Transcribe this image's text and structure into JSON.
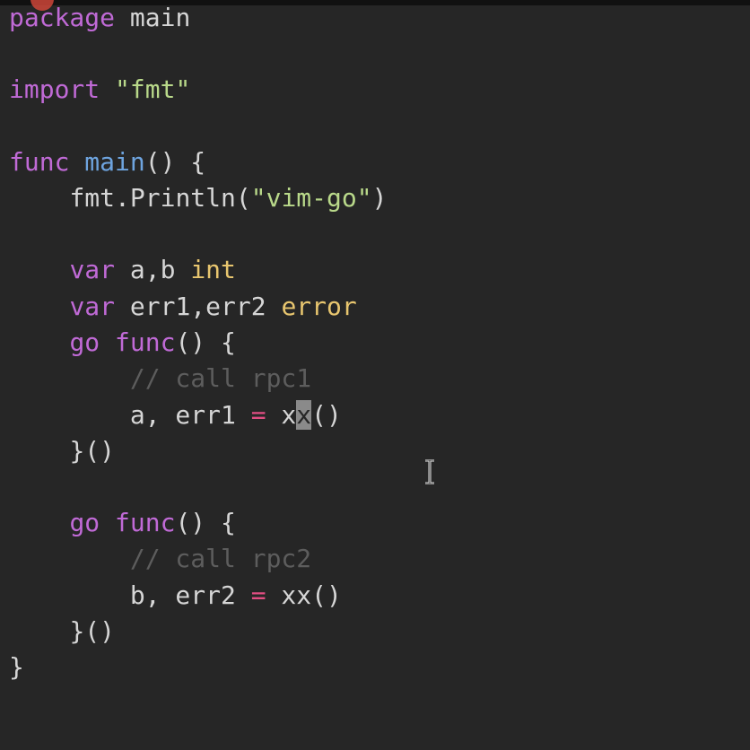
{
  "editor": {
    "language": "go",
    "colors": {
      "background": "#262626",
      "keyword": "#c06ad6",
      "string": "#b9d98a",
      "function": "#6ea4df",
      "type": "#e8c66f",
      "comment": "#5d5d5d",
      "operator": "#e24e83"
    },
    "lines": {
      "l1": {
        "kw": "package",
        "rest": " main"
      },
      "l3": {
        "kw": "import",
        "sp": " ",
        "str": "\"fmt\""
      },
      "l5": {
        "kw": "func",
        "sp": " ",
        "fn": "main",
        "rest": "() {"
      },
      "l6": {
        "indent": "    ",
        "a": "fmt.Println(",
        "str": "\"vim-go\"",
        "b": ")"
      },
      "l8": {
        "indent": "    ",
        "kw": "var",
        "mid": " a,b ",
        "type": "int"
      },
      "l9": {
        "indent": "    ",
        "kw": "var",
        "mid": " err1,err2 ",
        "type": "error"
      },
      "l10": {
        "indent": "    ",
        "kw": "go",
        "sp": " ",
        "kw2": "func",
        "rest": "() {"
      },
      "l11": {
        "indent": "        ",
        "cm": "// call rpc1"
      },
      "l12": {
        "indent": "        ",
        "a": "a, err1 ",
        "op": "=",
        "b": " x",
        "cur": "x",
        "c": "()"
      },
      "l13": {
        "indent": "    ",
        "text": "}()"
      },
      "l15": {
        "indent": "    ",
        "kw": "go",
        "sp": " ",
        "kw2": "func",
        "rest": "() {"
      },
      "l16": {
        "indent": "        ",
        "cm": "// call rpc2"
      },
      "l17": {
        "indent": "        ",
        "a": "b, err2 ",
        "op": "=",
        "b": " xx()"
      },
      "l18": {
        "indent": "    ",
        "text": "}()"
      },
      "l19": {
        "text": "}"
      }
    }
  }
}
